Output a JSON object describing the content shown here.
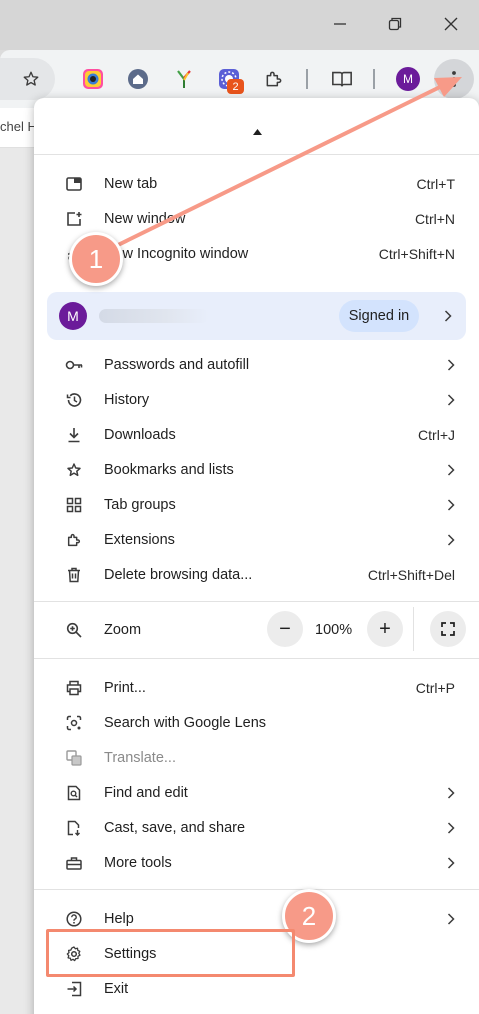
{
  "browser": {
    "bookmark_partial": "chel H",
    "extension_badge": "2",
    "profile_initial": "M"
  },
  "menu": {
    "group1": [
      {
        "label": "New tab",
        "shortcut": "Ctrl+T",
        "icon": "new-tab-icon"
      },
      {
        "label": "New window",
        "shortcut": "Ctrl+N",
        "icon": "new-window-icon"
      },
      {
        "label": "New Incognito window",
        "shortcut": "Ctrl+Shift+N",
        "icon": "incognito-icon"
      }
    ],
    "profile": {
      "initial": "M",
      "status": "Signed in"
    },
    "group2": [
      {
        "label": "Passwords and autofill",
        "icon": "key-icon"
      },
      {
        "label": "History",
        "icon": "history-icon"
      },
      {
        "label": "Downloads",
        "shortcut": "Ctrl+J",
        "icon": "download-icon"
      },
      {
        "label": "Bookmarks and lists",
        "icon": "star-icon"
      },
      {
        "label": "Tab groups",
        "icon": "tab-groups-icon"
      },
      {
        "label": "Extensions",
        "icon": "puzzle-icon"
      },
      {
        "label": "Delete browsing data...",
        "shortcut": "Ctrl+Shift+Del",
        "icon": "trash-icon"
      }
    ],
    "zoom": {
      "label": "Zoom",
      "value": "100%",
      "minus": "−",
      "plus": "+"
    },
    "group3": [
      {
        "label": "Print...",
        "shortcut": "Ctrl+P",
        "icon": "print-icon"
      },
      {
        "label": "Search with Google Lens",
        "icon": "lens-icon"
      },
      {
        "label": "Translate...",
        "icon": "translate-icon"
      },
      {
        "label": "Find and edit",
        "icon": "find-icon"
      },
      {
        "label": "Cast, save, and share",
        "icon": "cast-icon"
      },
      {
        "label": "More tools",
        "icon": "toolbox-icon"
      }
    ],
    "group4": [
      {
        "label": "Help",
        "icon": "help-icon"
      },
      {
        "label": "Settings",
        "icon": "gear-icon"
      },
      {
        "label": "Exit",
        "icon": "exit-icon"
      }
    ]
  },
  "annotations": {
    "step1": "1",
    "step2": "2"
  },
  "colors": {
    "accent": "#f79a88",
    "profile_bg": "#e8eefb",
    "pill_bg": "#d3e3fd",
    "avatar": "#6b1b9a"
  }
}
